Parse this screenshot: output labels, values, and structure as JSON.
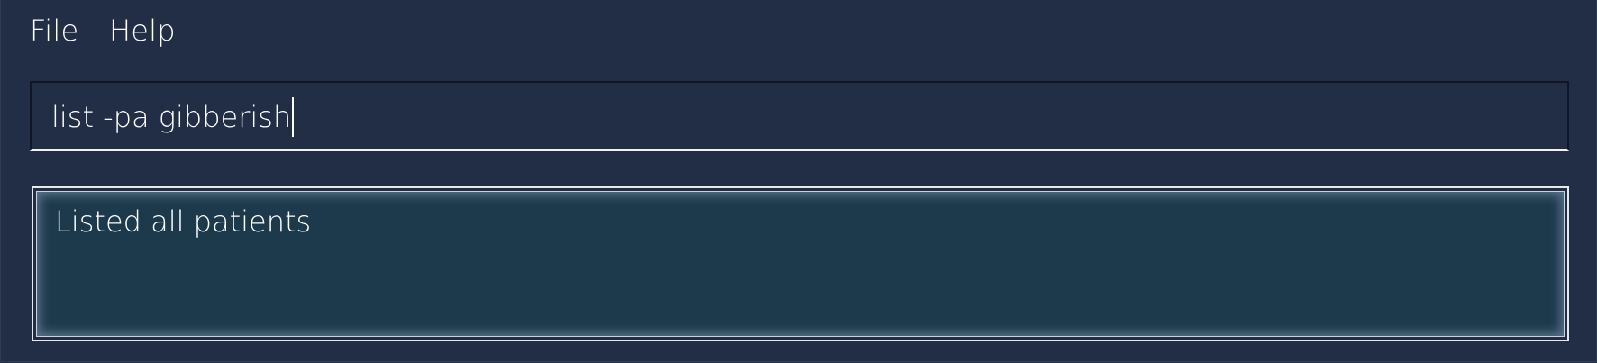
{
  "menubar": {
    "items": [
      {
        "label": "File"
      },
      {
        "label": "Help"
      }
    ]
  },
  "command_box": {
    "value": "list -pa gibberish"
  },
  "result_display": {
    "message": "Listed all patients"
  },
  "colors": {
    "background": "#222e46",
    "result_background": "#1d3a4d",
    "text": "#ffffff"
  }
}
